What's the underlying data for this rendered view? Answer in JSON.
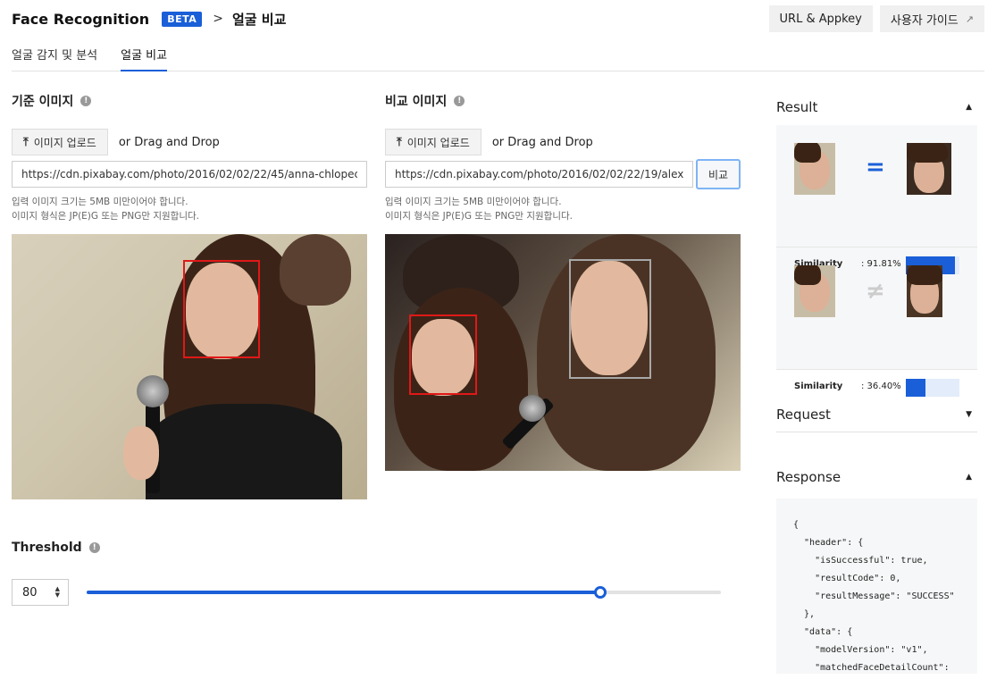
{
  "header": {
    "title": "Face Recognition",
    "badge": "BETA",
    "separator": ">",
    "breadcrumb": "얼굴 비교",
    "actions": [
      {
        "label": "URL & Appkey"
      },
      {
        "label": "사용자 가이드",
        "icon": "external-link-icon"
      }
    ]
  },
  "tabs": [
    {
      "label": "얼굴 감지 및 분석",
      "active": false
    },
    {
      "label": "얼굴 비교",
      "active": true
    }
  ],
  "source_panel": {
    "title": "기준 이미지",
    "upload_label": "이미지 업로드",
    "dnd_label": "or Drag and Drop",
    "url": "https://cdn.pixabay.com/photo/2016/02/02/22/45/anna-chlopecka-1176149_960_720.jpg",
    "hint_1": "입력 이미지 크기는 5MB 미만이어야 합니다.",
    "hint_2": "이미지 형식은 JP(E)G 또는 PNG만 지원합니다."
  },
  "target_panel": {
    "title": "비교 이미지",
    "upload_label": "이미지 업로드",
    "dnd_label": "or Drag and Drop",
    "url": "https://cdn.pixabay.com/photo/2016/02/02/22/19/alexi",
    "compare_label": "비교",
    "hint_1": "입력 이미지 크기는 5MB 미만이어야 합니다.",
    "hint_2": "이미지 형식은 JP(E)G 또는 PNG만 지원합니다."
  },
  "threshold": {
    "title": "Threshold",
    "value": "80",
    "slider_percent": 81
  },
  "sidebar": {
    "result_title": "Result",
    "request_title": "Request",
    "response_title": "Response",
    "results": [
      {
        "symbol": "=",
        "label": "Similarity",
        "value": ": 91.81%",
        "percent": 91.81,
        "match": true
      },
      {
        "symbol": "≠",
        "label": "Similarity",
        "value": ": 36.40%",
        "percent": 36.4,
        "match": false
      }
    ],
    "response_lines": [
      "{",
      "  \"header\": {",
      "    \"isSuccessful\": true,",
      "    \"resultCode\": 0,",
      "    \"resultMessage\": \"SUCCESS\"",
      "  },",
      "  \"data\": {",
      "    \"modelVersion\": \"v1\",",
      "    \"matchedFaceDetailCount\":"
    ]
  },
  "colors": {
    "accent": "#1a5fd8",
    "face_box_match": "#e01818",
    "face_box_other": "#a8a8a8"
  }
}
